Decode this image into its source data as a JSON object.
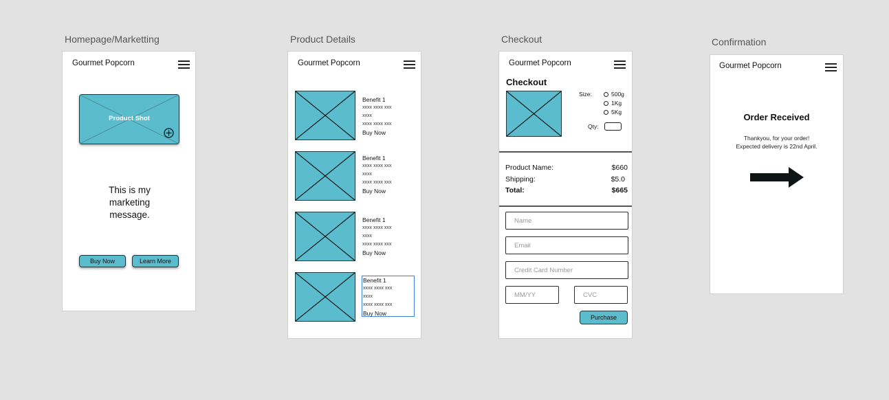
{
  "artboards": {
    "home": "Homepage/Marketting",
    "details": "Product Details",
    "checkout": "Checkout",
    "confirmation": "Confirmation"
  },
  "brand": "Gourmet Popcorn",
  "home": {
    "product_shot": "Product Shot",
    "marketing_line1": "This is my",
    "marketing_line2": "marketing",
    "marketing_line3": "message.",
    "buy_now": "Buy Now",
    "learn_more": "Learn More"
  },
  "details": {
    "products": [
      {
        "benefit": "Benefit 1",
        "line1": "xxxx xxxx xxx",
        "line2": "xxxx",
        "line3": "xxxx xxxx xxx",
        "cta": "Buy Now"
      },
      {
        "benefit": "Benefit 1",
        "line1": "xxxx xxxx xxx",
        "line2": "xxxx",
        "line3": "xxxx xxxx xxx",
        "cta": "Buy Now"
      },
      {
        "benefit": "Benefit 1",
        "line1": "xxxx xxxx xxx",
        "line2": "xxxx",
        "line3": "xxxx xxxx xxx",
        "cta": "Buy Now"
      },
      {
        "benefit": "Benefit 1",
        "line1": "xxxx xxxx xxx",
        "line2": "xxxx",
        "line3": "xxxx xxxx xxx",
        "cta": "Buy Now"
      }
    ]
  },
  "checkout": {
    "title": "Checkout",
    "size_label": "Size:",
    "size_options": [
      "500g",
      "1Kg",
      "5Kg"
    ],
    "qty_label": "Qty:",
    "summary": {
      "product_name_label": "Product Name:",
      "product_name_value": "$660",
      "shipping_label": "Shipping:",
      "shipping_value": "$5.0",
      "total_label": "Total:",
      "total_value": "$665"
    },
    "placeholders": {
      "name": "Name",
      "email": "Email",
      "card": "Credit Card Number",
      "expiry": "MM/YY",
      "cvc": "CVC"
    },
    "purchase": "Purchase"
  },
  "confirmation": {
    "title": "Order Received",
    "line1": "Thankyou, for your order!",
    "line2": "Expected delivery is 22nd April."
  },
  "colors": {
    "placeholder_fill": "#5bbccd",
    "canvas_bg": "#e2e2e2",
    "selection_blue": "#3d7fd9"
  }
}
